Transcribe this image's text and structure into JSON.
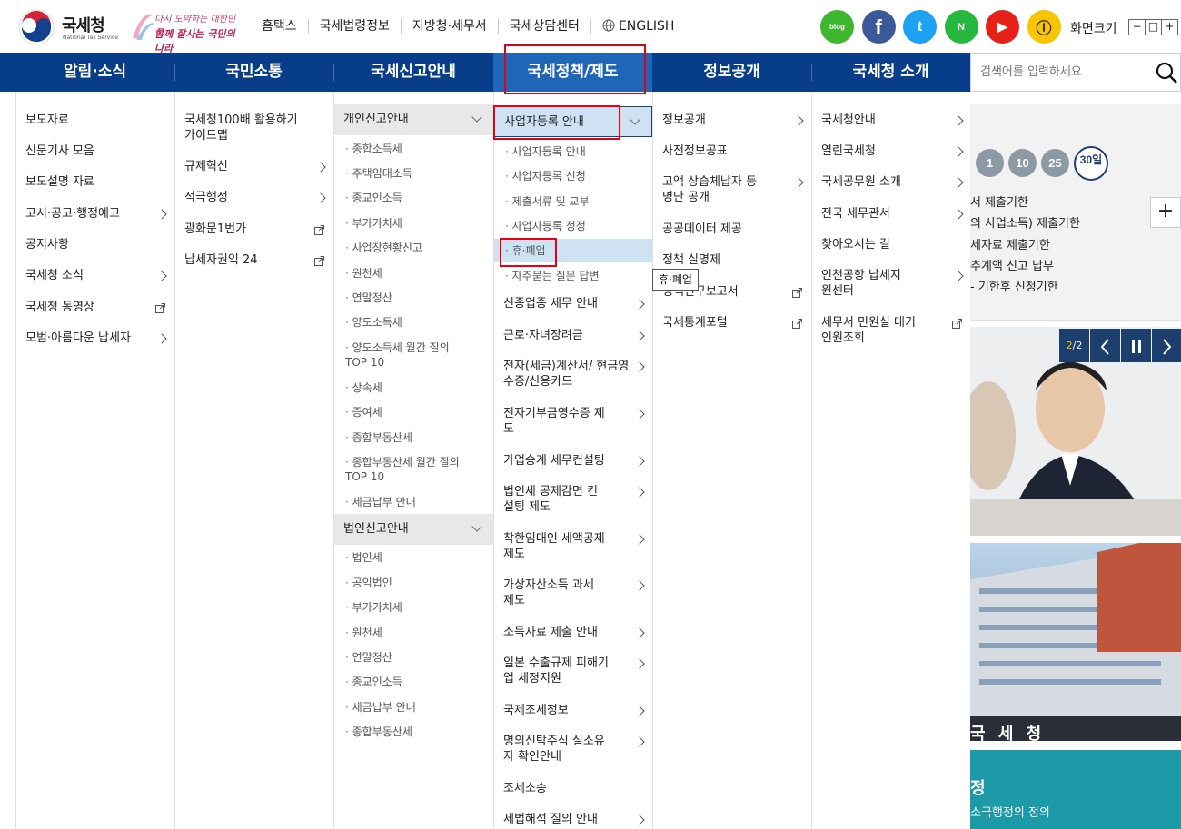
{
  "header": {
    "logo_ko": "국세청",
    "logo_en": "National Tax Service",
    "slogan_line1": "다시 도약하는 대한민국",
    "slogan_line2": "함께 잘사는 국민의 나라",
    "util_links": [
      "홈택스",
      "국세법령정보",
      "지방청·세무서",
      "국세상담센터",
      "ENGLISH"
    ],
    "sns": [
      "blog",
      "f",
      "t",
      "N",
      "▶",
      "ⓘ"
    ],
    "screen_size_label": "화면크기",
    "zoom": [
      "−",
      "□",
      "+"
    ]
  },
  "gnb": {
    "items": [
      "알림·소식",
      "국민소통",
      "국세신고안내",
      "국세정책/제도",
      "정보공개",
      "국세청 소개"
    ],
    "active": "국세정책/제도",
    "search_placeholder": "검색어를 입력하세요"
  },
  "menu": {
    "col1": [
      "보도자료",
      "신문기사 모음",
      "보도설명 자료",
      "고시·공고·행정예고",
      "공지사항",
      "국세청 소식",
      "국세청 동영상",
      "모범·아름다운 납세자"
    ],
    "col2": [
      "국세청100배 활용하기 가이드맵",
      "규제혁신",
      "적극행정",
      "광화문1번가",
      "납세자권익 24"
    ],
    "col3": {
      "group1": "개인신고안내",
      "group1_items": [
        "종합소득세",
        "주택임대소득",
        "종교인소득",
        "부가가치세",
        "사업장현황신고",
        "원천세",
        "연말정산",
        "양도소득세",
        "양도소득세 월간 질의 TOP 10",
        "상속세",
        "증여세",
        "종합부동산세",
        "종합부동산세 월간 질의 TOP 10",
        "세금납부 안내"
      ],
      "group2": "법인신고안내",
      "group2_items": [
        "법인세",
        "공익법인",
        "부가가치세",
        "원천세",
        "연말정산",
        "종교인소득",
        "세금납부 안내",
        "종합부동산세"
      ]
    },
    "col4": {
      "group": "사업자등록 안내",
      "group_items": [
        "사업자등록 안내",
        "사업자등록 신청",
        "제출서류 및 교부",
        "사업자등록 정정",
        "휴·폐업",
        "자주묻는 질문 답변"
      ],
      "items": [
        "신종업종 세무 안내",
        "근로·자녀장려금",
        "전자(세금)계산서/ 현금영수증/신용카드",
        "전자기부금영수증 제도",
        "가업승계 세무컨설팅",
        "법인세 공제감면 컨설팅 제도",
        "착한임대인 세액공제 제도",
        "가상자산소득 과세제도",
        "소득자료 제출 안내",
        "일본 수출규제 피해기업 세정지원",
        "국제조세정보",
        "명의신탁주식 실소유자 확인안내",
        "조세소송",
        "세법해석 질의 안내"
      ]
    },
    "col5": [
      "정보공개",
      "사전정보공표",
      "고액 상습체납자 등 명단 공개",
      "공공데이터 제공",
      "정책 실명제",
      "정책연구보고서",
      "국세통계포털"
    ],
    "col6": [
      "국세청안내",
      "열린국세청",
      "국세공무원 소개",
      "전국 세무관서",
      "찾아오시는 길",
      "인천공항 납세지원센터",
      "세무서 민원실 대기인원조회"
    ],
    "tooltip": "휴·폐업"
  },
  "right": {
    "day_filters": [
      "1",
      "10",
      "25",
      "30일"
    ],
    "deadlines": [
      "서 제출기한",
      "의 사업소득) 제출기한",
      "세자료 제출기한",
      "추계액 신고 납부",
      "- 기한후 신청기한"
    ],
    "slide_counter_current": "2",
    "slide_counter_total": "2",
    "banner_title": "정",
    "banner_text": "소극행정의 정의",
    "building_sign": "국 세 청"
  },
  "colors": {
    "nav_bg": "#083d8a",
    "nav_active": "#1f66b8",
    "highlight": "#cfe2f3",
    "annotation_red": "#e60012",
    "teal": "#1c9aa8"
  }
}
